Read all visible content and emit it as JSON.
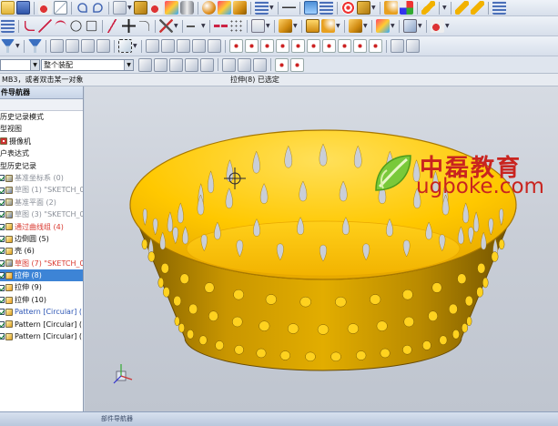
{
  "toolbar_rows": [
    [
      "folder-icon",
      "save-icon",
      "sep",
      "cut-icon",
      "copy-icon",
      "sep",
      "undo-icon",
      "redo-icon",
      "sep",
      "snap-icon",
      "arrow",
      "box-icon",
      "cut-icon",
      "paint-icon",
      "cylinder-icon",
      "sep",
      "sphere-icon",
      "paint-icon",
      "cube-icon",
      "sep",
      "grid-icon",
      "arrow",
      "sep",
      "dash-icon",
      "sep",
      "layers-icon",
      "grid-icon",
      "sep",
      "target-icon",
      "box-icon",
      "arrow",
      "sep",
      "blend-icon",
      "move-icon",
      "sep",
      "pencil-icon",
      "sep",
      "arrow",
      "sep",
      "pencil-icon",
      "pencil-icon",
      "sep",
      "grid-icon"
    ],
    [
      "grid-icon",
      "sep",
      "spline-icon",
      "line-icon",
      "arc-icon",
      "circle-icon",
      "rect-icon",
      "sep",
      "polyline-icon",
      "plus-icon",
      "fillet-icon",
      "sep",
      "trim-icon",
      "arrow",
      "sep",
      "extend-icon",
      "arrow",
      "sep",
      "mirror-icon",
      "pattern-icon",
      "sep",
      "sketch-icon",
      "arrow",
      "sep",
      "cube-icon",
      "arrow",
      "sep",
      "extrude-icon",
      "blend-icon",
      "arrow",
      "sep",
      "cube-icon",
      "arrow",
      "sep",
      "paint-icon",
      "arrow",
      "sep",
      "face-icon",
      "arrow",
      "sep",
      "cut-icon",
      "arrow"
    ],
    [
      "filter-icon",
      "arrow",
      "sep",
      "filter-icon",
      "sep",
      "snap-icon",
      "snap-icon",
      "snap-icon",
      "snap-icon",
      "sep",
      "select-icon",
      "arrow",
      "sep",
      "snap-icon",
      "snap-icon",
      "snap-icon",
      "snap-icon",
      "snap-icon",
      "sep",
      "point-icon",
      "point-icon",
      "point-icon",
      "point-icon",
      "point-icon",
      "point-icon",
      "point-icon",
      "point-icon",
      "point-icon",
      "point-icon",
      "sep",
      "snap-icon",
      "snap-icon"
    ]
  ],
  "selection_bar": {
    "filter_value": "",
    "scope_value": "整个装配"
  },
  "status_bar": {
    "prompt": "MB3，或者双击某一对象",
    "status": "拉伸(8) 已选定"
  },
  "navigator": {
    "title": "件导航器",
    "items": [
      {
        "label": "历史记录模式",
        "check": false,
        "color": "normal",
        "icon": "none"
      },
      {
        "label": "型视图",
        "check": false,
        "color": "normal",
        "icon": "none"
      },
      {
        "label": "摄像机",
        "check": false,
        "color": "normal",
        "icon": "camera"
      },
      {
        "label": "户表达式",
        "check": false,
        "color": "normal",
        "icon": "none"
      },
      {
        "label": "型历史记录",
        "check": false,
        "color": "normal",
        "icon": "none"
      },
      {
        "label": "基准坐标系 (0)",
        "check": true,
        "color": "gray",
        "icon": "csys"
      },
      {
        "label": "草图 (1) \"SKETCH_0",
        "check": true,
        "color": "gray",
        "icon": "sketch"
      },
      {
        "label": "基准平面 (2)",
        "check": true,
        "color": "gray",
        "icon": "plane"
      },
      {
        "label": "草图 (3) \"SKETCH_0",
        "check": true,
        "color": "gray",
        "icon": "sketch"
      },
      {
        "label": "通过曲线组 (4)",
        "check": true,
        "color": "red",
        "icon": "surface"
      },
      {
        "label": "边倒圆 (5)",
        "check": true,
        "color": "normal",
        "icon": "blend"
      },
      {
        "label": "壳 (6)",
        "check": true,
        "color": "normal",
        "icon": "shell"
      },
      {
        "label": "草图 (7) \"SKETCH_0",
        "check": true,
        "color": "red",
        "icon": "sketch"
      },
      {
        "label": "拉伸 (8)",
        "check": true,
        "color": "selected",
        "icon": "extrude"
      },
      {
        "label": "拉伸 (9)",
        "check": true,
        "color": "normal",
        "icon": "extrude"
      },
      {
        "label": "拉伸 (10)",
        "check": true,
        "color": "normal",
        "icon": "extrude"
      },
      {
        "label": "Pattern [Circular] (",
        "check": true,
        "color": "blue",
        "icon": "pattern"
      },
      {
        "label": "Pattern [Circular] (",
        "check": true,
        "color": "normal",
        "icon": "pattern"
      },
      {
        "label": "Pattern [Circular] (",
        "check": true,
        "color": "normal",
        "icon": "pattern"
      }
    ]
  },
  "viewport": {
    "model": "perforated-bowl",
    "model_color": "#f5b800",
    "inner_color": "#ffd21f",
    "hole_color": "#c9ced7",
    "cursor": "crosshair-icon",
    "triad": "wcs-triad-icon"
  },
  "watermark": {
    "cn": "中磊教育",
    "en": "ugboke.com",
    "color": "#c9241f",
    "leaf_color": "#6cbf2a"
  },
  "taskbar": {
    "tab_label": "部件导航器"
  },
  "colors": {
    "toolbar_bg": "#e4e9f1",
    "selected_row": "#3d84d6",
    "accent_red": "#d9382f",
    "accent_blue": "#2c55b4"
  }
}
